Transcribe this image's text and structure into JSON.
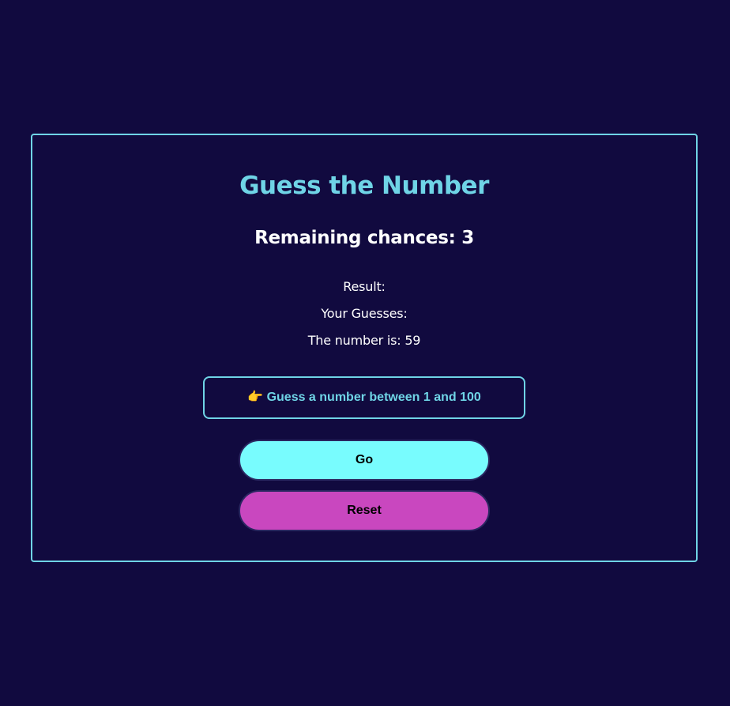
{
  "game": {
    "title": "Guess the Number",
    "chances_label": "Remaining chances: ",
    "chances_value": "3",
    "result_label": "Result:",
    "result_value": "",
    "guesses_label": "Your Guesses:",
    "guesses_value": "",
    "number_label": "The number is: ",
    "number_value": "59"
  },
  "input": {
    "placeholder": "👉 Guess a number between 1 and 100",
    "value": ""
  },
  "buttons": {
    "go_label": "Go",
    "reset_label": "Reset"
  },
  "colors": {
    "background": "#110a3f",
    "accent": "#6fd4e6",
    "go_button": "#78fcfe",
    "reset_button": "#c947bf"
  }
}
